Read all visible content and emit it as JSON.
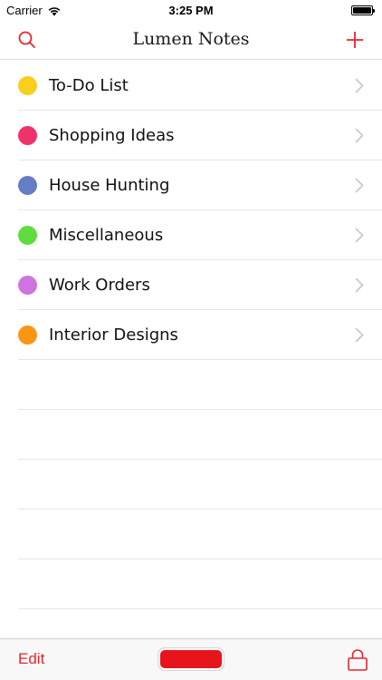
{
  "status_bar": {
    "carrier": "Carrier",
    "time": "3:25 PM",
    "battery_level": 1.0
  },
  "nav": {
    "title": "Lumen Notes",
    "left_icon": "search-icon",
    "right_icon": "plus-icon",
    "accent_color": "#e5262d"
  },
  "notebooks": [
    {
      "label": "To-Do List",
      "color": "#f7cf1e"
    },
    {
      "label": "Shopping Ideas",
      "color": "#f0326b"
    },
    {
      "label": "House Hunting",
      "color": "#637ec5"
    },
    {
      "label": "Miscellaneous",
      "color": "#5fdc3e"
    },
    {
      "label": "Work Orders",
      "color": "#cf73e0"
    },
    {
      "label": "Interior Designs",
      "color": "#fb9613"
    }
  ],
  "toolbar": {
    "edit_label": "Edit",
    "center_button_color": "#e8141c",
    "right_icon": "lock-icon"
  }
}
